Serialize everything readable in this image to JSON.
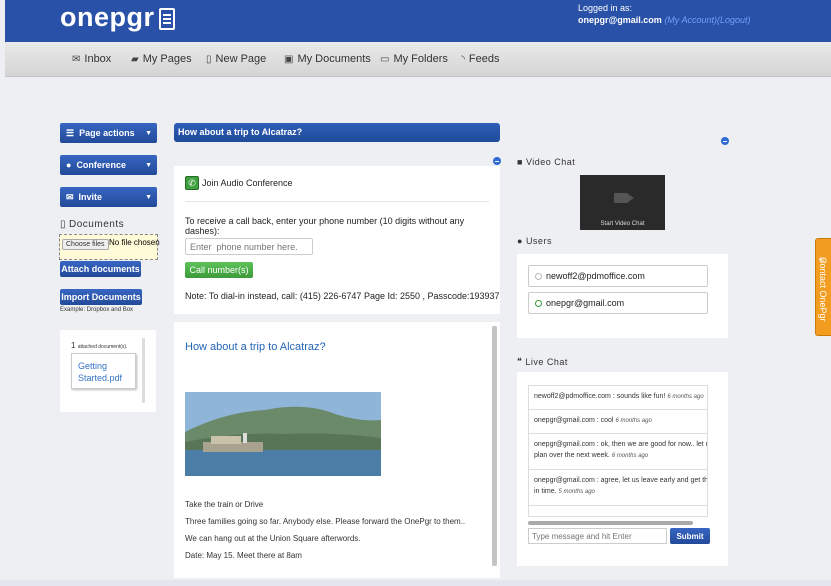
{
  "header": {
    "logo": "onepgr",
    "logged_in_label": "Logged in as:",
    "email": "onepgr@gmail.com",
    "my_account": "(My Account)",
    "logout": "(Logout)"
  },
  "nav": {
    "items": [
      {
        "label": "Inbox",
        "icon": "envelope-icon"
      },
      {
        "label": "My Pages",
        "icon": "book-icon"
      },
      {
        "label": "New Page",
        "icon": "file-icon"
      },
      {
        "label": "My Documents",
        "icon": "briefcase-icon"
      },
      {
        "label": "My Folders",
        "icon": "folder-icon"
      },
      {
        "label": "Feeds",
        "icon": "rss-icon"
      }
    ]
  },
  "sidebar": {
    "page_actions": "Page actions",
    "conference": "Conference",
    "invite": "Invite",
    "documents_label": "Documents",
    "choose_files": "Choose files",
    "no_file": "No file chosen",
    "attach_button": "Attach documents",
    "import_button": "Import Documents",
    "import_hint": "Example: Dropbox and Box",
    "attached_count": "1",
    "attached_suffix": "attached document(s).",
    "attached_file": "Getting Started.pdf"
  },
  "page": {
    "title": "How about a trip to Alcatraz?"
  },
  "conference": {
    "header": "Join Audio Conference",
    "instruction": "To receive a call back, enter your phone number (10 digits without any dashes):",
    "phone_placeholder": "Enter  phone number here.",
    "call_button": "Call number(s)",
    "note": "Note: To dial-in instead, call: (415) 226-6747 Page Id: 2550  , Passcode:193937"
  },
  "content": {
    "heading": "How about a trip to Alcatraz?",
    "lines": [
      "Take the train or Drive",
      "Three families going so far. Anybody else. Please forward the OnePgr to them..",
      "We can hang out at the Union Square afterwords.",
      "Date: May 15. Meet there at 8am"
    ]
  },
  "video_chat": {
    "label": "Video Chat",
    "start_label": "Start Video Chat"
  },
  "users": {
    "label": "Users",
    "list": [
      {
        "email": "newoff2@pdmoffice.com",
        "online": false
      },
      {
        "email": "onepgr@gmail.com",
        "online": true
      }
    ]
  },
  "live_chat": {
    "label": "Live Chat",
    "messages": [
      {
        "text": "newoff2@pdmoffice.com : sounds like fun!",
        "ago": "6 months ago",
        "cont": ""
      },
      {
        "text": "onepgr@gmail.com : cool",
        "ago": "6 months ago",
        "cont": ""
      },
      {
        "text": "onepgr@gmail.com : ok, then we are good for now.. let us",
        "ago": "6 months ago",
        "cont": "plan over the next week."
      },
      {
        "text": "onepgr@gmail.com : agree, let us leave early and get there",
        "ago": "5 months ago",
        "cont": "in time."
      }
    ],
    "input_placeholder": "Type message and hit Enter",
    "submit": "Submit"
  },
  "contact_tab": {
    "label": "Contact OnePgr"
  },
  "colors": {
    "brand_blue": "#2951a8",
    "button_green": "#4aaf46",
    "contact_orange": "#f29d1f",
    "link_blue": "#2466b8"
  }
}
